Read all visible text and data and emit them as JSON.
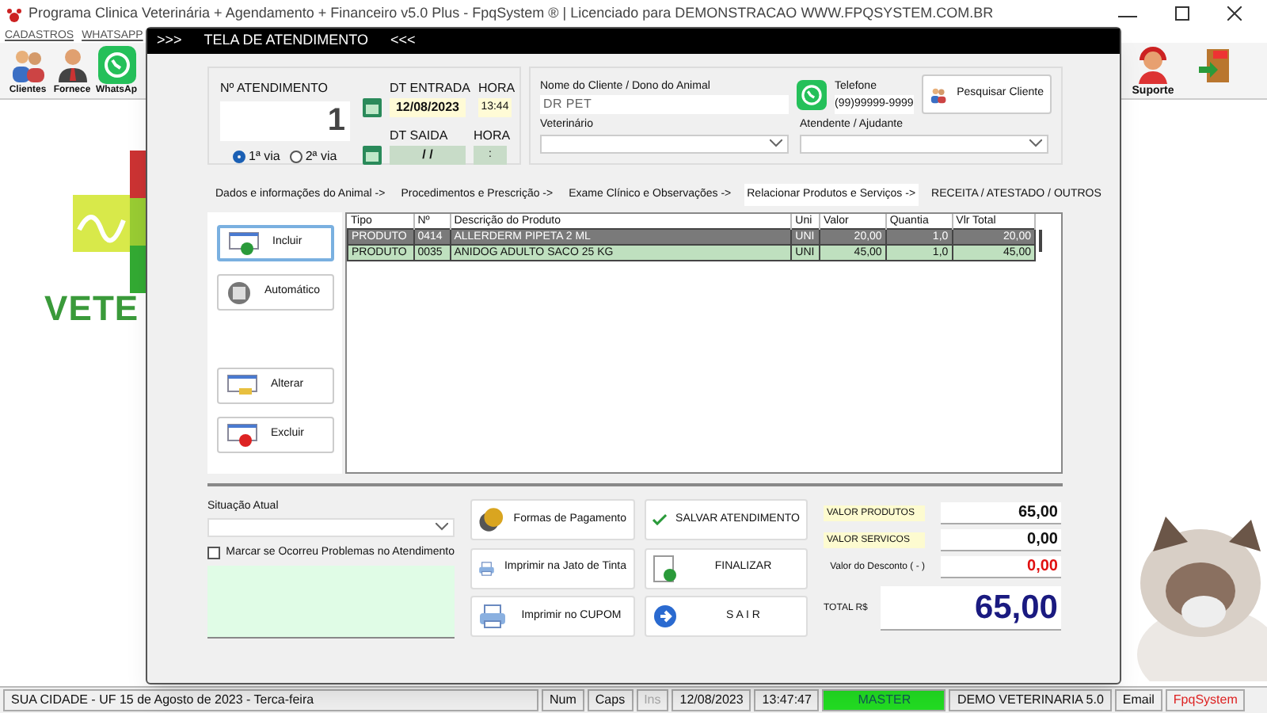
{
  "app": {
    "title": "Programa Clinica Veterinária + Agendamento + Financeiro v5.0 Plus - FpqSystem ® | Licenciado para  DEMONSTRACAO WWW.FPQSYSTEM.COM.BR",
    "menu": [
      "CADASTROS",
      "WHATSAPP"
    ],
    "toolbar_left": [
      {
        "label": "Clientes",
        "kind": "people"
      },
      {
        "label": "Fornece",
        "kind": "person"
      },
      {
        "label": "WhatsAp",
        "kind": "whatsapp"
      }
    ],
    "toolbar_right": [
      {
        "label": "Suporte",
        "kind": "support"
      },
      {
        "kind": "exit"
      }
    ],
    "logo_text": "VETE"
  },
  "dialog": {
    "title_left": ">>>",
    "title": "TELA DE ATENDIMENTO",
    "title_right": "<<<",
    "atendimento": {
      "label": "Nº ATENDIMENTO",
      "value": "1",
      "vias": [
        {
          "label": "1ª via",
          "selected": true
        },
        {
          "label": "2ª via",
          "selected": false
        }
      ]
    },
    "entrada": {
      "label": "DT ENTRADA",
      "date": "12/08/2023",
      "hora_label": "HORA",
      "hora": "13:44"
    },
    "saida": {
      "label": "DT SAIDA",
      "date": " /  /",
      "hora_label": "HORA",
      "hora": ":"
    },
    "cliente": {
      "label": "Nome do Cliente / Dono do Animal",
      "value": "DR PET"
    },
    "telefone": {
      "label": "Telefone",
      "value": "(99)99999-9999"
    },
    "search_button": "Pesquisar Cliente",
    "veterinario": {
      "label": "Veterinário"
    },
    "atendente": {
      "label": "Atendente / Ajudante"
    },
    "tabs": [
      {
        "label": "Dados e informações do Animal ->",
        "selected": false
      },
      {
        "label": "Procedimentos e Prescrição ->",
        "selected": false
      },
      {
        "label": "Exame Clínico e Observações ->",
        "selected": false
      },
      {
        "label": "Relacionar Produtos e Serviços ->",
        "selected": true
      },
      {
        "label": "RECEITA / ATESTADO / OUTROS",
        "selected": false
      }
    ],
    "side_buttons": [
      {
        "label": "Incluir",
        "kind": "add"
      },
      {
        "label": "Automático",
        "kind": "auto"
      },
      {
        "label": "Alterar",
        "kind": "edit"
      },
      {
        "label": "Excluir",
        "kind": "delete"
      }
    ],
    "table": {
      "columns": [
        "Tipo",
        "Nº",
        "Descrição do Produto",
        "Uni",
        "Valor",
        "Quantia",
        "Vlr Total"
      ],
      "rows": [
        {
          "cells": [
            "PRODUTO",
            "0414",
            "ALLERDERM PIPETA 2 ML",
            "UNI",
            "20,00",
            "1,0",
            "20,00"
          ],
          "selected": true
        },
        {
          "cells": [
            "PRODUTO",
            "0035",
            "ANIDOG ADULTO SACO 25 KG",
            "UNI",
            "45,00",
            "1,0",
            "45,00"
          ],
          "selected": false
        }
      ]
    },
    "situacao": {
      "label": "Situação Atual"
    },
    "problema": {
      "label": "Marcar se Ocorreu Problemas no Atendimento",
      "checked": false
    },
    "actions": [
      {
        "label": "Formas de Pagamento",
        "kind": "coins"
      },
      {
        "label": "SALVAR  ATENDIMENTO",
        "kind": "check"
      },
      {
        "label": "Imprimir na Jato de Tinta",
        "kind": "printer"
      },
      {
        "label": "FINALIZAR",
        "kind": "document"
      },
      {
        "label": "Imprimir no CUPOM",
        "kind": "printer"
      },
      {
        "label": "S A I R",
        "kind": "arrow"
      }
    ],
    "totals": [
      {
        "label": "VALOR PRODUTOS",
        "value": "65,00",
        "kind": "highlight"
      },
      {
        "label": "VALOR SERVICOS",
        "value": "0,00",
        "kind": "highlight"
      },
      {
        "label": "Valor do Desconto ( - )",
        "value": "0,00",
        "kind": "discount"
      }
    ],
    "total": {
      "label": "TOTAL R$",
      "value": "65,00"
    }
  },
  "status_bar": {
    "location": "SUA CIDADE - UF 15 de Agosto de 2023 - Terca-feira",
    "num": "Num",
    "caps": "Caps",
    "ins": "Ins",
    "date": "12/08/2023",
    "time": "13:47:47",
    "user": "MASTER",
    "company": "DEMO VETERINARIA 5.0",
    "email": "Email",
    "brand": "FpqSystem"
  }
}
